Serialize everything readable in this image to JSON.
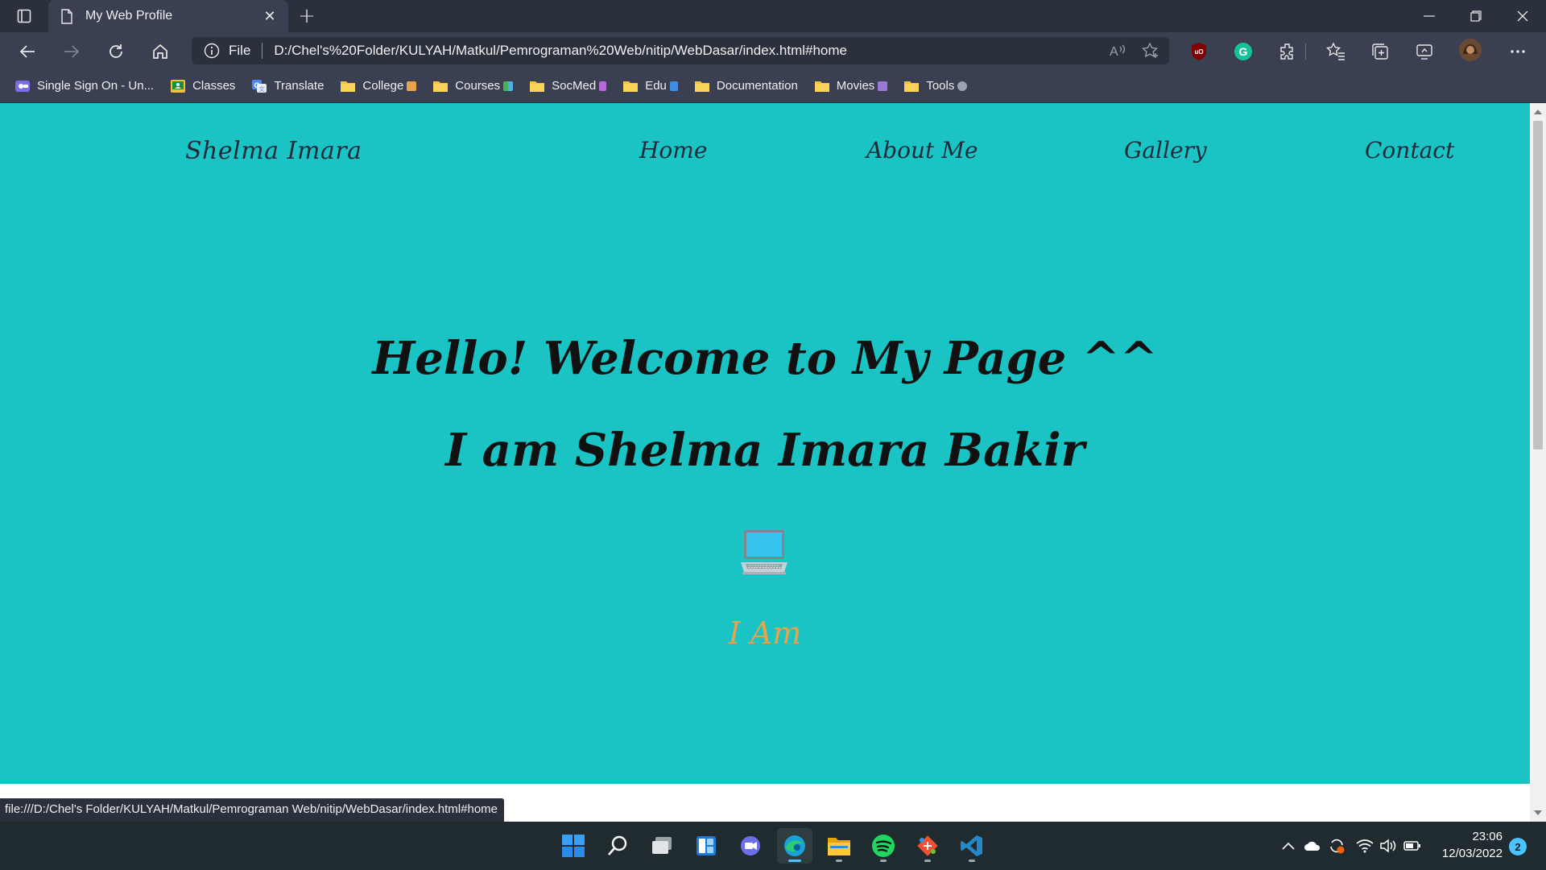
{
  "browser": {
    "tab_title": "My Web Profile",
    "address_scheme_label": "File",
    "address_url": "D:/Chel's%20Folder/KULYAH/Matkul/Pemrograman%20Web/nitip/WebDasar/index.html#home",
    "status_url": "file:///D:/Chel's Folder/KULYAH/Matkul/Pemrograman Web/nitip/WebDasar/index.html#home"
  },
  "bookmarks": [
    {
      "label": "Single Sign On - Un...",
      "icon": "sso-icon",
      "color": "#7b6ee8"
    },
    {
      "label": "Classes",
      "icon": "classroom-icon",
      "color": "#f2c13a"
    },
    {
      "label": "Translate",
      "icon": "translate-icon",
      "color": "#4a8af4"
    },
    {
      "label": "College",
      "icon": "folder-icon",
      "color": "#f5c542",
      "emoji_color": "#e6a44a"
    },
    {
      "label": "Courses",
      "icon": "folder-icon",
      "color": "#f5c542",
      "emoji_color": "#4fb0e8"
    },
    {
      "label": "SocMed",
      "icon": "folder-icon",
      "color": "#f5c542",
      "emoji_color": "#b36ad6"
    },
    {
      "label": "Edu",
      "icon": "folder-icon",
      "color": "#f5c542",
      "emoji_color": "#3b8fe6"
    },
    {
      "label": "Documentation",
      "icon": "folder-icon",
      "color": "#f5c542"
    },
    {
      "label": "Movies",
      "icon": "folder-icon",
      "color": "#f5c542",
      "emoji_color": "#9a7ad6"
    },
    {
      "label": "Tools",
      "icon": "folder-icon",
      "color": "#f5c542",
      "emoji_color": "#9aa2b0"
    }
  ],
  "site": {
    "brand": "Shelma Imara",
    "nav": [
      "Home",
      "About Me",
      "Gallery",
      "Contact"
    ],
    "hero_title": "Hello! Welcome to My Page ^^",
    "hero_name": "I am Shelma Imara Bakir",
    "subtitle": "I Am",
    "subtitle_color": "#e6a44a",
    "background_color": "#1bc4c4"
  },
  "taskbar": {
    "time": "23:06",
    "date": "12/03/2022",
    "notification_count": "2",
    "apps": [
      "start-icon",
      "search-icon",
      "task-view-icon",
      "widgets-icon",
      "chat-icon",
      "edge-icon",
      "file-explorer-icon",
      "spotify-icon",
      "git-icon",
      "vscode-icon"
    ]
  }
}
